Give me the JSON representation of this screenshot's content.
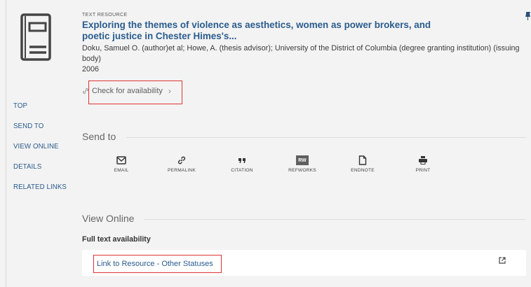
{
  "record": {
    "type_label": "TEXT RESOURCE",
    "title": "Exploring the themes of violence as aesthetics, women as power brokers, and poetic justice in Chester Himes's...",
    "authors": "Doku, Samuel O. (author)et al; Howe, A. (thesis advisor); University of the District of Columbia (degree granting institution) (issuing body)",
    "year": "2006",
    "availability_label": "Check for availability"
  },
  "nav": {
    "items": [
      "TOP",
      "SEND TO",
      "VIEW ONLINE",
      "DETAILS",
      "RELATED LINKS"
    ]
  },
  "send_to": {
    "title": "Send to",
    "actions": [
      {
        "label": "EMAIL",
        "icon": "email-icon"
      },
      {
        "label": "PERMALINK",
        "icon": "link-icon"
      },
      {
        "label": "CITATION",
        "icon": "quote-icon"
      },
      {
        "label": "REFWORKS",
        "icon": "refworks-icon",
        "badge": "RW"
      },
      {
        "label": "ENDNOTE",
        "icon": "document-icon"
      },
      {
        "label": "PRINT",
        "icon": "print-icon"
      }
    ]
  },
  "view_online": {
    "title": "View Online",
    "full_text_label": "Full text availability",
    "link_label": "Link to Resource - Other Statuses"
  },
  "colors": {
    "link": "#2a5c8e",
    "highlight": "#e03434",
    "background": "#f3f3f3"
  }
}
